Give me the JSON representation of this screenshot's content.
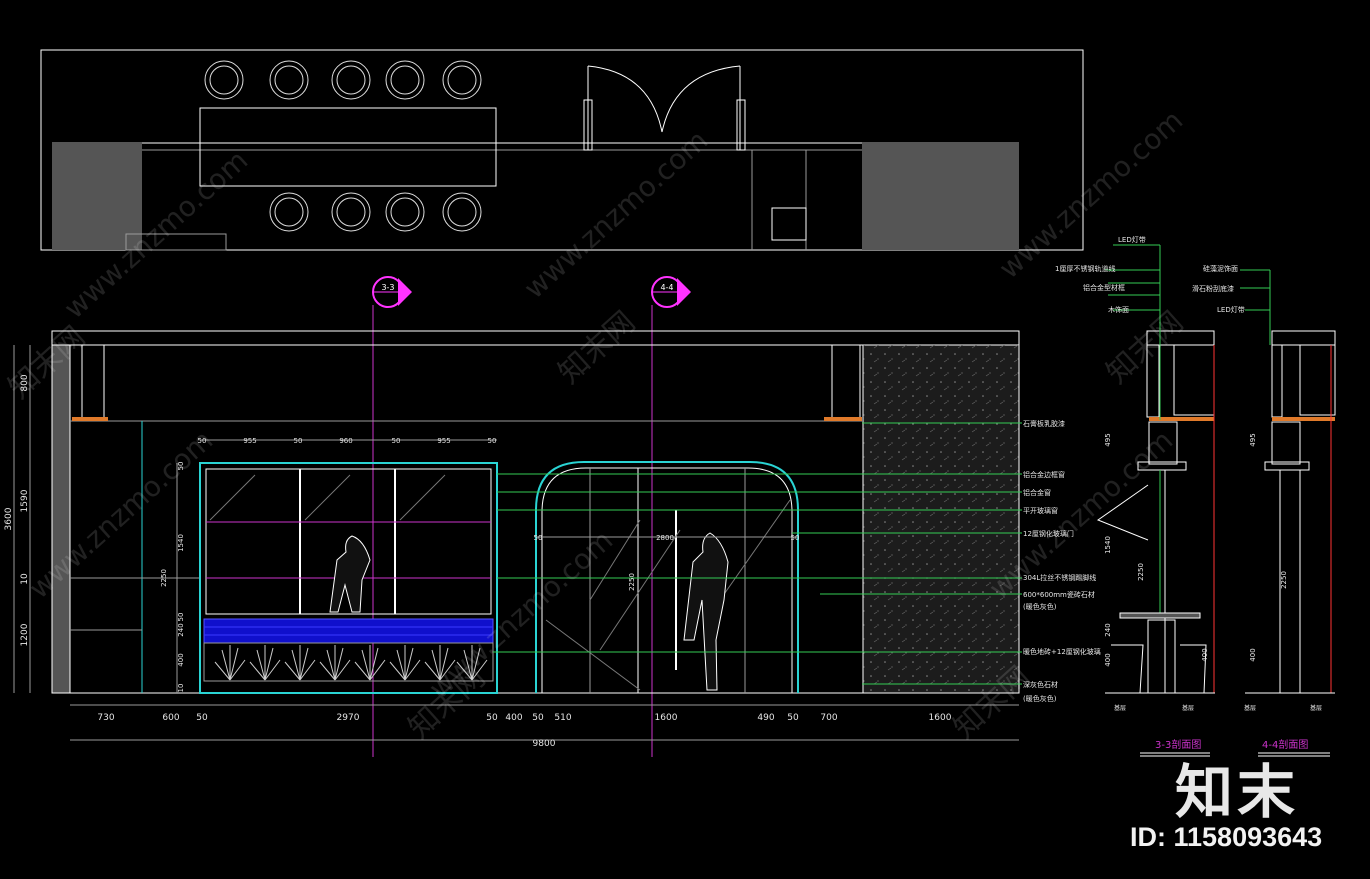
{
  "colors": {
    "background": "#000000",
    "line_white": "#ffffff",
    "line_gray": "#9a9a9a",
    "leader_green": "#33cc55",
    "section_magenta": "#ff33ff",
    "title_magenta": "#cc33cc",
    "cyan": "#2ad4d4",
    "fill_gray": "#555555",
    "sofa_blue": "#1010cc",
    "orange": "#e07a2a"
  },
  "section_markers": [
    {
      "label": "3-3"
    },
    {
      "label": "4-4"
    }
  ],
  "elevation": {
    "left_dims": [
      "800",
      "1590",
      "10",
      "1200"
    ],
    "left_overall": "3600",
    "bottom_dims": [
      "730",
      "600",
      "50",
      "2970",
      "50",
      "400",
      "50",
      "510",
      "1600",
      "490",
      "50",
      "700",
      "1600"
    ],
    "overall_width": "9800",
    "window_top_dims": [
      "50",
      "955",
      "50",
      "960",
      "50",
      "955",
      "50"
    ],
    "window_side_dims": [
      "50",
      "1540",
      "50",
      "240",
      "400",
      "10"
    ],
    "window_height": "2250",
    "door_top_dims": [
      "50",
      "2800",
      "50"
    ],
    "door_height": "2250"
  },
  "annotations": [
    "石膏板乳胶漆",
    "铝合金边框窗",
    "铝合金窗",
    "平开玻璃窗",
    "12厘钢化玻璃门",
    "304L拉丝不锈钢踢脚线",
    "600*600mm瓷砖石材",
    "(暖色灰色)",
    "暖色地砖+12厘钢化玻璃",
    "深灰色石材",
    "(暖色灰色)"
  ],
  "section_notes": {
    "left": [
      "LED灯带",
      "1厘厚不锈钢轨道线",
      "铝合金型材框",
      "木饰面"
    ],
    "right": [
      "硅藻泥饰面",
      "滑石粉刮底漆",
      "LED灯带"
    ]
  },
  "section_dims": {
    "s33": [
      "495",
      "1540",
      "2250",
      "240",
      "400"
    ],
    "s44": [
      "495",
      "2250",
      "400"
    ]
  },
  "section_titles": [
    "3-3剖面图",
    "4-4剖面图"
  ],
  "section_base_labels": [
    "基层",
    "基层",
    "基层",
    "基层"
  ],
  "watermark_text": "www.znzmo.com",
  "watermark_cn": "知末网",
  "brand_logo": "知末",
  "id_label": "ID: 1158093643"
}
